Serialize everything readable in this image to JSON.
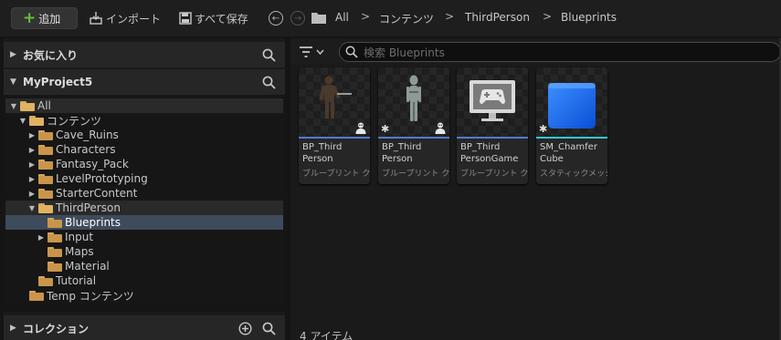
{
  "toolbar": {
    "add_label": "追加",
    "import_label": "インポート",
    "save_all_label": "すべて保存"
  },
  "breadcrumb": [
    "All",
    "コンテンツ",
    "ThirdPerson",
    "Blueprints"
  ],
  "left": {
    "favorites_label": "お気に入り",
    "project_label": "MyProject5",
    "collections_label": "コレクション",
    "tree": [
      {
        "label": "All",
        "depth": 0,
        "expanded": true,
        "arrow": "down",
        "highlight": true
      },
      {
        "label": "コンテンツ",
        "depth": 1,
        "expanded": true,
        "arrow": "down"
      },
      {
        "label": "Cave_Ruins",
        "depth": 2,
        "arrow": "right"
      },
      {
        "label": "Characters",
        "depth": 2,
        "arrow": "right"
      },
      {
        "label": "Fantasy_Pack",
        "depth": 2,
        "arrow": "right"
      },
      {
        "label": "LevelPrototyping",
        "depth": 2,
        "arrow": "right"
      },
      {
        "label": "StarterContent",
        "depth": 2,
        "arrow": "right"
      },
      {
        "label": "ThirdPerson",
        "depth": 2,
        "expanded": true,
        "arrow": "down",
        "highlight": true
      },
      {
        "label": "Blueprints",
        "depth": 3,
        "selected": true
      },
      {
        "label": "Input",
        "depth": 3,
        "arrow": "right"
      },
      {
        "label": "Maps",
        "depth": 3
      },
      {
        "label": "Material",
        "depth": 3
      },
      {
        "label": "Tutorial",
        "depth": 2
      },
      {
        "label": "Temp コンテンツ",
        "depth": 1
      }
    ]
  },
  "search": {
    "placeholder": "検索 Blueprints"
  },
  "assets": [
    {
      "name": "BP_Third\nPerson",
      "type": "ブループリント クラス",
      "bar_color": "#4f7ad9",
      "thumb": "character-dark",
      "star": false
    },
    {
      "name": "BP_Third\nPerson",
      "type": "ブループリント クラス",
      "bar_color": "#4f7ad9",
      "thumb": "character-light",
      "star": true
    },
    {
      "name": "BP_Third\nPersonGame",
      "type": "ブループリント クラス",
      "bar_color": "#4f7ad9",
      "thumb": "gamemode-monitor",
      "star": false
    },
    {
      "name": "SM_Chamfer\nCube",
      "type": "スタティックメッシュ",
      "bar_color": "#32c8d2",
      "thumb": "blue-cube",
      "star": true
    }
  ],
  "status": {
    "item_count": "4 アイテム"
  }
}
